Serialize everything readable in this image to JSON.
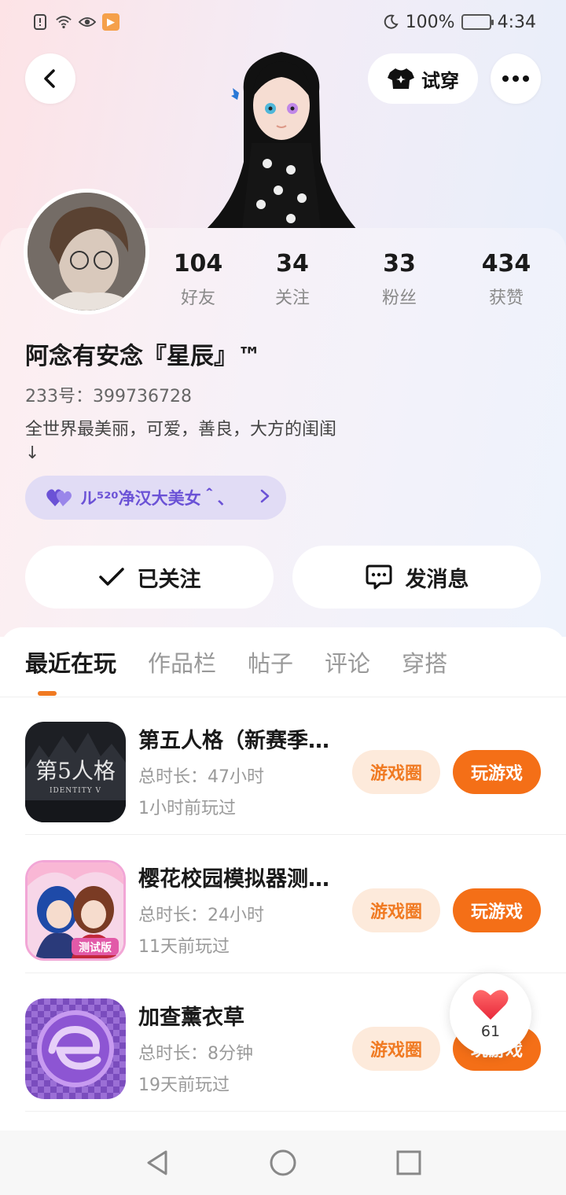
{
  "status_bar": {
    "battery": "100%",
    "time": "4:34"
  },
  "header": {
    "try_on_label": "试穿"
  },
  "profile": {
    "stats": [
      {
        "value": "104",
        "label": "好友"
      },
      {
        "value": "34",
        "label": "关注"
      },
      {
        "value": "33",
        "label": "粉丝"
      },
      {
        "value": "434",
        "label": "获赞"
      }
    ],
    "nickname": "阿念有安念『星辰』™",
    "uid": "233号：399736728",
    "bio": "全世界最美丽，可爱，善良，大方的闺闺\n↓",
    "badge_text": "ル⁵²⁰净汉大美女＾、"
  },
  "actions": {
    "follow_label": "已关注",
    "message_label": "发消息"
  },
  "tabs": [
    "最近在玩",
    "作品栏",
    "帖子",
    "评论",
    "穿搭"
  ],
  "games": [
    {
      "title": "第五人格（新赛季…",
      "duration": "总时长：47小时",
      "last_played": "1小时前玩过",
      "circle_label": "游戏圈",
      "play_label": "玩游戏",
      "icon": "identity-v-icon",
      "icon_text": "第5人格",
      "icon_subtext": "IDENTITY V"
    },
    {
      "title": "樱花校园模拟器测…",
      "duration": "总时长：24小时",
      "last_played": "11天前玩过",
      "circle_label": "游戏圈",
      "play_label": "玩游戏",
      "icon": "sakura-school-icon",
      "icon_text": "测试版"
    },
    {
      "title": "加查薰衣草",
      "duration": "总时长：8分钟",
      "last_played": "19天前玩过",
      "circle_label": "游戏圈",
      "play_label": "玩游戏",
      "icon": "gacha-lavender-icon"
    }
  ],
  "like_float": {
    "count": "61"
  },
  "colors": {
    "accent": "#f46f17",
    "accent_light": "#fdeadb",
    "badge_purple": "#6b52d6"
  }
}
